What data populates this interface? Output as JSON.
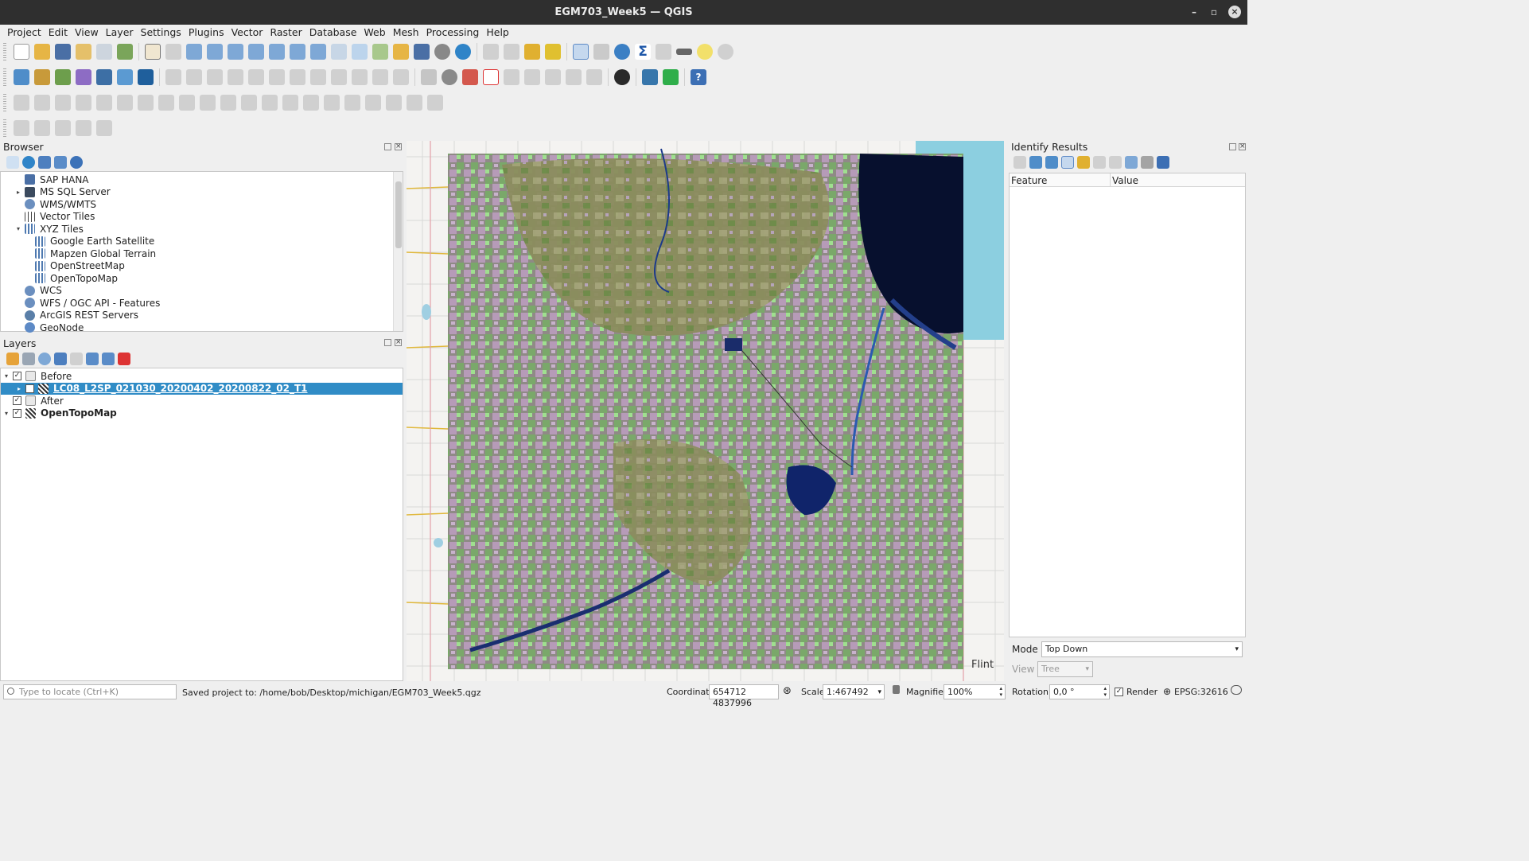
{
  "window": {
    "title": "EGM703_Week5 — QGIS"
  },
  "menu": [
    "Project",
    "Edit",
    "View",
    "Layer",
    "Settings",
    "Plugins",
    "Vector",
    "Raster",
    "Database",
    "Web",
    "Mesh",
    "Processing",
    "Help"
  ],
  "browser": {
    "title": "Browser",
    "items": [
      {
        "label": "SAP HANA",
        "icon": "sap-hana-icon",
        "indent": 0,
        "expand": ""
      },
      {
        "label": "MS SQL Server",
        "icon": "mssql-icon",
        "indent": 0,
        "expand": "▸"
      },
      {
        "label": "WMS/WMTS",
        "icon": "wms-globe-icon",
        "indent": 0,
        "expand": ""
      },
      {
        "label": "Vector Tiles",
        "icon": "vector-tiles-icon",
        "indent": 0,
        "expand": ""
      },
      {
        "label": "XYZ Tiles",
        "icon": "xyz-grid-icon",
        "indent": 0,
        "expand": "▾"
      },
      {
        "label": "Google Earth Satellite",
        "icon": "xyz-grid-icon",
        "indent": 1,
        "expand": ""
      },
      {
        "label": "Mapzen Global Terrain",
        "icon": "xyz-grid-icon",
        "indent": 1,
        "expand": ""
      },
      {
        "label": "OpenStreetMap",
        "icon": "xyz-grid-icon",
        "indent": 1,
        "expand": ""
      },
      {
        "label": "OpenTopoMap",
        "icon": "xyz-grid-icon",
        "indent": 1,
        "expand": ""
      },
      {
        "label": "WCS",
        "icon": "wcs-globe-icon",
        "indent": 0,
        "expand": ""
      },
      {
        "label": "WFS / OGC API - Features",
        "icon": "wfs-globe-icon",
        "indent": 0,
        "expand": ""
      },
      {
        "label": "ArcGIS REST Servers",
        "icon": "arcgis-icon",
        "indent": 0,
        "expand": ""
      },
      {
        "label": "GeoNode",
        "icon": "geonode-icon",
        "indent": 0,
        "expand": ""
      }
    ]
  },
  "layers": {
    "title": "Layers",
    "items": [
      {
        "label": "Before",
        "type": "group",
        "checked": true,
        "indent": 0,
        "expand": "▾",
        "bold": false,
        "selected": false
      },
      {
        "label": "LC08_L2SP_021030_20200402_20200822_02_T1",
        "type": "raster",
        "checked": true,
        "indent": 1,
        "expand": "▸",
        "bold": true,
        "selected": true
      },
      {
        "label": "After",
        "type": "group",
        "checked": true,
        "indent": 0,
        "expand": "",
        "bold": false,
        "selected": false
      },
      {
        "label": "OpenTopoMap",
        "type": "raster",
        "checked": true,
        "indent": 0,
        "expand": "▾",
        "bold": true,
        "selected": false
      }
    ]
  },
  "identify": {
    "title": "Identify Results",
    "col_feature": "Feature",
    "col_value": "Value",
    "mode_label": "Mode",
    "mode_value": "Top Down",
    "view_label": "View",
    "view_value": "Tree"
  },
  "map": {
    "place_label": "Flint",
    "lake_color": "#8ccfe0",
    "water_dark": "#07102e"
  },
  "status": {
    "locate_placeholder": "Type to locate (Ctrl+K)",
    "message": "Saved project to: /home/bob/Desktop/michigan/EGM703_Week5.qgz",
    "coordinate_label": "Coordinate",
    "coordinate_value": "654712 4837996",
    "scale_label": "Scale",
    "scale_value": "1:467492",
    "magnifier_label": "Magnifier",
    "magnifier_value": "100%",
    "rotation_label": "Rotation",
    "rotation_value": "0,0 °",
    "render_label": "Render",
    "crs": "EPSG:32616"
  },
  "colors": {
    "selection": "#308cc6",
    "accent": "#2f2f2f"
  }
}
